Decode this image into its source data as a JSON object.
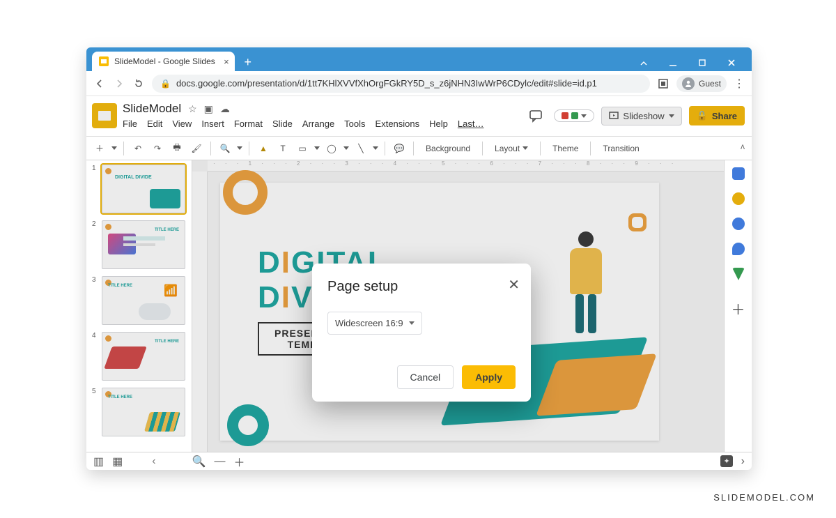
{
  "watermark": "SLIDEMODEL.COM",
  "browser": {
    "tab_title": "SlideModel - Google Slides",
    "url": "docs.google.com/presentation/d/1tt7KHlXVVfXhOrgFGkRY5D_s_z6jNHN3IwWrP6CDylc/edit#slide=id.p1",
    "guest_label": "Guest"
  },
  "doc": {
    "title": "SlideModel",
    "menus": [
      "File",
      "Edit",
      "View",
      "Insert",
      "Format",
      "Slide",
      "Arrange",
      "Tools",
      "Extensions",
      "Help",
      "Last…"
    ],
    "slideshow_label": "Slideshow",
    "share_label": "Share"
  },
  "toolbar": {
    "background": "Background",
    "layout": "Layout",
    "theme": "Theme",
    "transition": "Transition"
  },
  "thumbs": {
    "count": 5,
    "label1": "DIGITAL DIVIDE",
    "title_here": "TITLE HERE"
  },
  "canvas": {
    "title_line": "DIGITAL DIVIDE",
    "subtitle_line1": "PRESENTATION",
    "subtitle_line2": "TEMPLATE"
  },
  "ruler_marks": "· · · 1 · · · 2 · · · 3 · · · 4 · · · 5 · · · 6 · · · 7 · · · 8 · · · 9 · · ·",
  "dialog": {
    "title": "Page setup",
    "selected_option": "Widescreen 16:9",
    "cancel": "Cancel",
    "apply": "Apply"
  }
}
